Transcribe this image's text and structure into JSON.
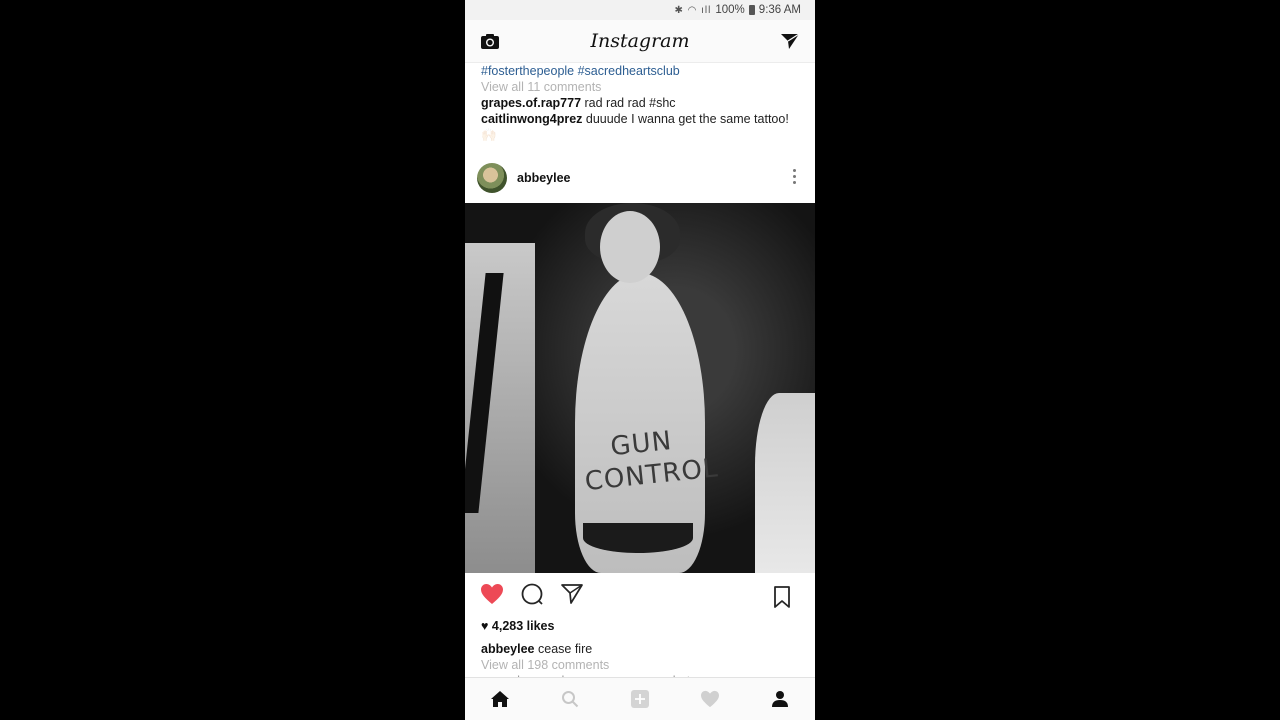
{
  "status_bar": {
    "battery": "100%",
    "time": "9:36 AM",
    "icons": "bluetooth wifi signal battery"
  },
  "header": {
    "title": "Instagram"
  },
  "prev_post": {
    "hashtags": "#fosterthepeople #sacredheartsclub",
    "view_comments": "View all 11 comments",
    "comments": [
      {
        "user": "grapes.of.rap777",
        "text": " rad rad rad #shc"
      },
      {
        "user": "caitlinwong4prez",
        "text": " duuude I wanna get the same tattoo!"
      }
    ],
    "emoji": "🙌🏻"
  },
  "post": {
    "username": "abbeylee",
    "photo_text": "GUN CONTROL",
    "liked": true,
    "likes": "4,283 likes",
    "caption_user": "abbeylee",
    "caption_text": " cease fire",
    "view_comments": "View all 198 comments",
    "cut_comment": "sssmehassand...aners awesome shot"
  },
  "colors": {
    "like": "#ed4956",
    "link": "#2d5e92",
    "muted": "#b3b3b3"
  }
}
